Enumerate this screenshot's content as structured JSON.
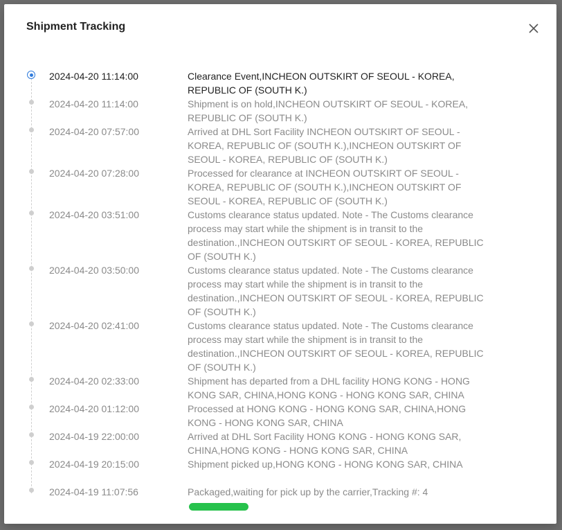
{
  "dialog": {
    "title": "Shipment Tracking",
    "close_icon": "close-icon"
  },
  "events": [
    {
      "time": "2024-04-20 11:14:00",
      "text": "Clearance Event,INCHEON OUTSKIRT OF SEOUL - KOREA, REPUBLIC OF (SOUTH K.)",
      "status": "current"
    },
    {
      "time": "2024-04-20 11:14:00",
      "text": "Shipment is on hold,INCHEON OUTSKIRT OF SEOUL - KOREA, REPUBLIC OF (SOUTH K.)"
    },
    {
      "time": "2024-04-20 07:57:00",
      "text": "Arrived at DHL Sort Facility INCHEON OUTSKIRT OF SEOUL - KOREA, REPUBLIC OF (SOUTH K.),INCHEON OUTSKIRT OF SEOUL - KOREA, REPUBLIC OF (SOUTH K.)"
    },
    {
      "time": "2024-04-20 07:28:00",
      "text": "Processed for clearance at INCHEON OUTSKIRT OF SEOUL - KOREA, REPUBLIC OF (SOUTH K.),INCHEON OUTSKIRT OF SEOUL - KOREA, REPUBLIC OF (SOUTH K.)"
    },
    {
      "time": "2024-04-20 03:51:00",
      "text": "Customs clearance status updated. Note - The Customs clearance process may start while the shipment is in transit to the destination.,INCHEON OUTSKIRT OF SEOUL - KOREA, REPUBLIC OF (SOUTH K.)"
    },
    {
      "time": "2024-04-20 03:50:00",
      "text": "Customs clearance status updated. Note - The Customs clearance process may start while the shipment is in transit to the destination.,INCHEON OUTSKIRT OF SEOUL - KOREA, REPUBLIC OF (SOUTH K.)"
    },
    {
      "time": "2024-04-20 02:41:00",
      "text": "Customs clearance status updated. Note - The Customs clearance process may start while the shipment is in transit to the destination.,INCHEON OUTSKIRT OF SEOUL - KOREA, REPUBLIC OF (SOUTH K.)"
    },
    {
      "time": "2024-04-20 02:33:00",
      "text": "Shipment has departed from a DHL facility HONG KONG - HONG KONG SAR, CHINA,HONG KONG - HONG KONG SAR, CHINA"
    },
    {
      "time": "2024-04-20 01:12:00",
      "text": "Processed at HONG KONG - HONG KONG SAR, CHINA,HONG KONG - HONG KONG SAR, CHINA"
    },
    {
      "time": "2024-04-19 22:00:00",
      "text": "Arrived at DHL Sort Facility HONG KONG - HONG KONG SAR, CHINA,HONG KONG - HONG KONG SAR, CHINA"
    },
    {
      "time": "2024-04-19 20:15:00",
      "text": "Shipment picked up,HONG KONG - HONG KONG SAR, CHINA"
    },
    {
      "time": "2024-04-19 11:07:56",
      "text": "Packaged,waiting for pick up by the carrier,Tracking #: 4"
    }
  ],
  "colors": {
    "accent": "#2f7bdc",
    "muted_text": "#8a8a8a",
    "current_text": "#222222",
    "redaction": "#27c24c"
  }
}
